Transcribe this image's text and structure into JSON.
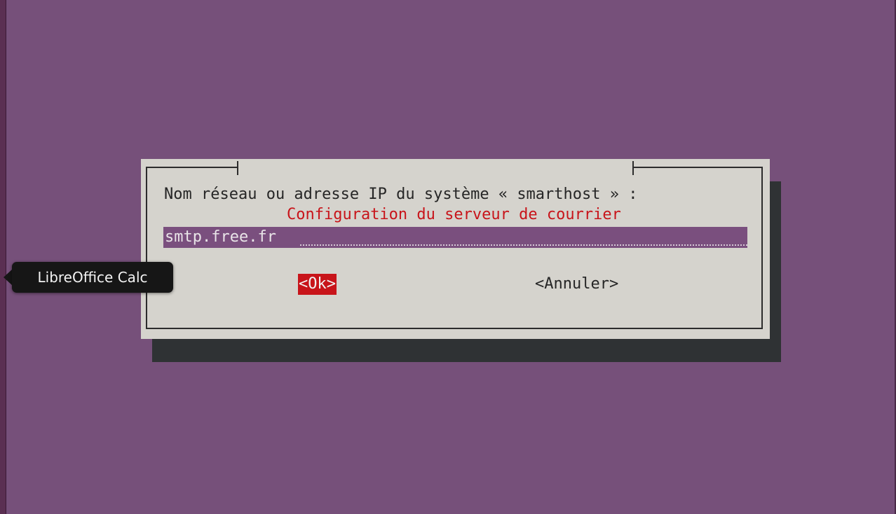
{
  "dialog": {
    "title": "Configuration du serveur de courrier",
    "prompt": "Nom réseau ou adresse IP du système « smarthost » :",
    "input_value": "smtp.free.fr",
    "ok_label": "<Ok>",
    "cancel_label": "<Annuler>"
  },
  "tooltip": {
    "text": "LibreOffice Calc"
  },
  "colors": {
    "background": "#76507a",
    "dialog_bg": "#d5d3cd",
    "accent_red": "#c8141a",
    "input_bg": "#7a4f7e",
    "shadow": "#2f3234"
  }
}
